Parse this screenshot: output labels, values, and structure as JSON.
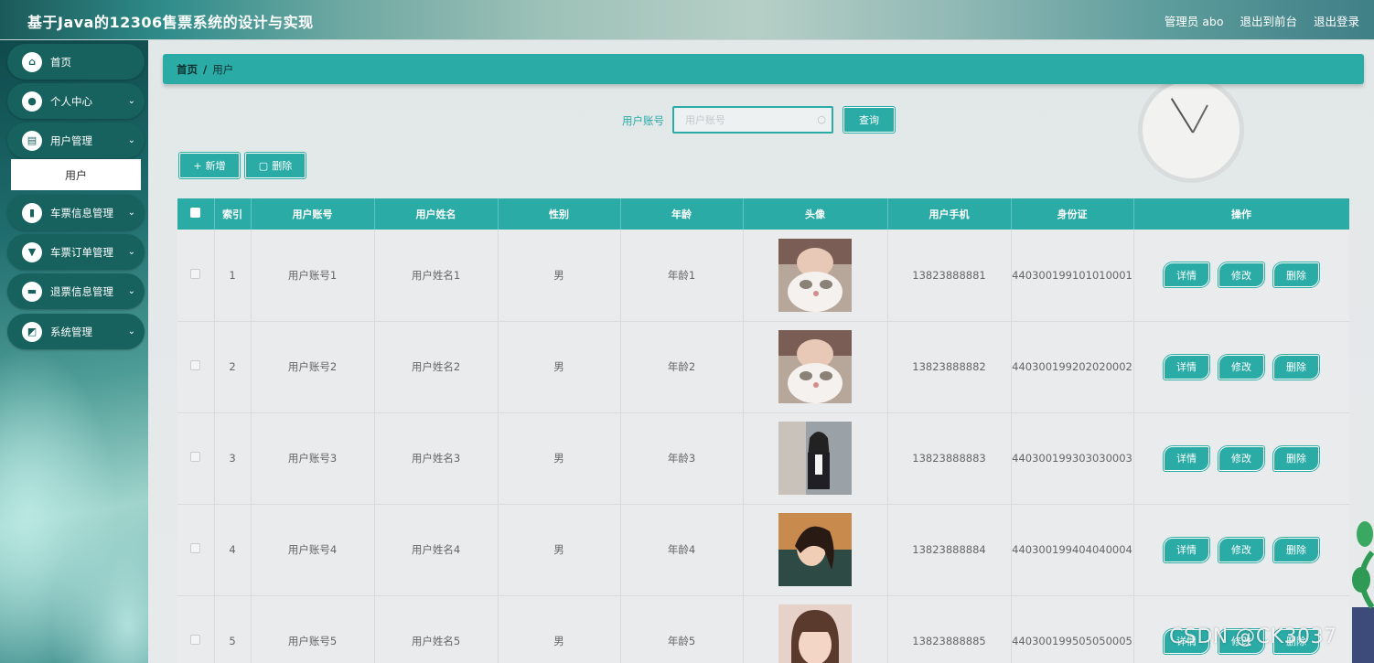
{
  "header": {
    "title": "基于Java的12306售票系统的设计与实现",
    "links": [
      "管理员 abo",
      "退出到前台",
      "退出登录"
    ]
  },
  "sidebar": {
    "items": [
      {
        "label": "首页",
        "icon": "home-icon",
        "glyph": "⌂"
      },
      {
        "label": "个人中心",
        "icon": "user-icon",
        "glyph": "●"
      },
      {
        "label": "用户管理",
        "icon": "clipboard-icon",
        "glyph": "▤"
      },
      {
        "label": "车票信息管理",
        "icon": "chart-icon",
        "glyph": "▮"
      },
      {
        "label": "车票订单管理",
        "icon": "cup-icon",
        "glyph": "▼"
      },
      {
        "label": "退票信息管理",
        "icon": "briefcase-icon",
        "glyph": "▬"
      },
      {
        "label": "系统管理",
        "icon": "settings-icon",
        "glyph": "◩"
      }
    ],
    "submenu": "用户"
  },
  "breadcrumb": {
    "home": "首页",
    "sep": "/",
    "current": "用户"
  },
  "search": {
    "label": "用户账号",
    "placeholder": "用户账号",
    "value": "",
    "button": "查询"
  },
  "toolbar": {
    "add": "新增",
    "delete": "删除"
  },
  "table": {
    "headers": [
      "索引",
      "用户账号",
      "用户姓名",
      "性别",
      "年龄",
      "头像",
      "用户手机",
      "身份证",
      "操作"
    ],
    "rows": [
      {
        "index": "1",
        "account": "用户账号1",
        "name": "用户姓名1",
        "gender": "男",
        "age": "年龄1",
        "phone": "13823888881",
        "id_card": "440300199101010001"
      },
      {
        "index": "2",
        "account": "用户账号2",
        "name": "用户姓名2",
        "gender": "男",
        "age": "年龄2",
        "phone": "13823888882",
        "id_card": "440300199202020002"
      },
      {
        "index": "3",
        "account": "用户账号3",
        "name": "用户姓名3",
        "gender": "男",
        "age": "年龄3",
        "phone": "13823888883",
        "id_card": "440300199303030003"
      },
      {
        "index": "4",
        "account": "用户账号4",
        "name": "用户姓名4",
        "gender": "男",
        "age": "年龄4",
        "phone": "13823888884",
        "id_card": "440300199404040004"
      },
      {
        "index": "5",
        "account": "用户账号5",
        "name": "用户姓名5",
        "gender": "男",
        "age": "年龄5",
        "phone": "13823888885",
        "id_card": "440300199505050005"
      }
    ],
    "actions": {
      "detail": "详情",
      "edit": "修改",
      "delete": "删除"
    }
  },
  "watermark": "CSDN @CK3037",
  "colors": {
    "accent": "#2aaba6",
    "menu": "#17625f"
  }
}
